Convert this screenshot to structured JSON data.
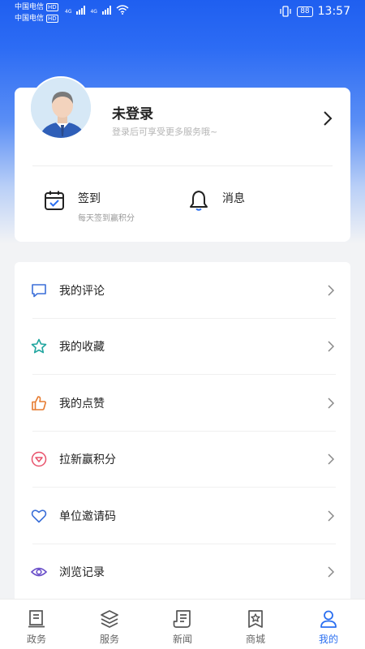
{
  "status_bar": {
    "carrier1": "中国电信",
    "carrier2": "中国电信",
    "hd1": "HD",
    "hd2": "HD",
    "net1": "4G",
    "net2": "4G",
    "battery": "88",
    "time": "13:57"
  },
  "profile": {
    "title": "未登录",
    "subtitle": "登录后可享受更多服务哦~",
    "checkin": {
      "title": "签到",
      "subtitle": "每天签到赢积分"
    },
    "messages": {
      "title": "消息"
    }
  },
  "menu": {
    "items": [
      {
        "label": "我的评论",
        "icon": "comment-icon"
      },
      {
        "label": "我的收藏",
        "icon": "star-icon"
      },
      {
        "label": "我的点赞",
        "icon": "thumbs-up-icon"
      },
      {
        "label": "拉新赢积分",
        "icon": "invite-icon"
      },
      {
        "label": "单位邀请码",
        "icon": "heart-icon"
      },
      {
        "label": "浏览记录",
        "icon": "eye-icon"
      }
    ]
  },
  "tabs": [
    {
      "label": "政务",
      "icon": "government-icon"
    },
    {
      "label": "服务",
      "icon": "layers-icon"
    },
    {
      "label": "新闻",
      "icon": "news-icon"
    },
    {
      "label": "商城",
      "icon": "mall-icon"
    },
    {
      "label": "我的",
      "icon": "user-icon",
      "active": true
    }
  ],
  "colors": {
    "accent": "#2b6ff0",
    "icon_blue": "#3b6fd8",
    "icon_teal": "#22a6a0",
    "icon_orange": "#e67a2e",
    "icon_red": "#e8526b"
  }
}
